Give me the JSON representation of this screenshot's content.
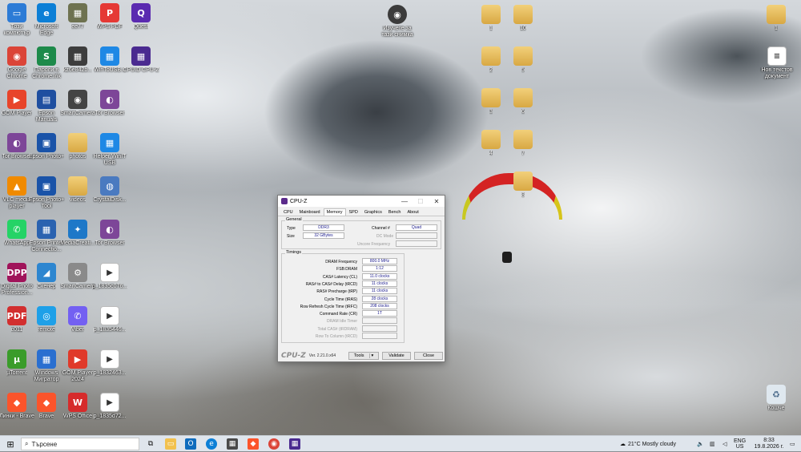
{
  "desktop": {
    "icons": [
      {
        "label": "Този компютър",
        "glyph": "▭",
        "color": "#2c7bd6",
        "col": 0,
        "row": 0
      },
      {
        "label": "Google Chrome",
        "glyph": "◉",
        "color": "#db4437",
        "col": 0,
        "row": 1
      },
      {
        "label": "GOM Player",
        "glyph": "▶",
        "color": "#e8442a",
        "col": 0,
        "row": 2
      },
      {
        "label": "Tor Browser",
        "glyph": "◐",
        "color": "#7d4698",
        "col": 0,
        "row": 3
      },
      {
        "label": "VLC media player",
        "glyph": "▲",
        "color": "#f08a00",
        "col": 0,
        "row": 4
      },
      {
        "label": "WhatsApp",
        "glyph": "✆",
        "color": "#25d366",
        "col": 0,
        "row": 5
      },
      {
        "label": "Digital Photo Profession...",
        "glyph": "DPP",
        "color": "#a0145a",
        "col": 0,
        "row": 6
      },
      {
        "label": "c011",
        "glyph": "PDF",
        "color": "#d22f2f",
        "col": 0,
        "row": 7
      },
      {
        "label": "µTorrent",
        "glyph": "µ",
        "color": "#3a9c2a",
        "col": 0,
        "row": 8
      },
      {
        "label": "Линки - Brave",
        "glyph": "◆",
        "color": "#fb542b",
        "col": 0,
        "row": 9
      },
      {
        "label": "Microsoft Edge",
        "glyph": "e",
        "color": "#0c7fd6",
        "col": 1,
        "row": 0
      },
      {
        "label": "Пароли в Chrome.lnk",
        "glyph": "S",
        "color": "#1d8a4a",
        "col": 1,
        "row": 1
      },
      {
        "label": "Epson Manuals",
        "glyph": "▤",
        "color": "#1f4fa0",
        "col": 1,
        "row": 2
      },
      {
        "label": "Epson Photo+",
        "glyph": "▣",
        "color": "#1a53a8",
        "col": 1,
        "row": 3
      },
      {
        "label": "Epson Photo+ Tool",
        "glyph": "▣",
        "color": "#1a53a8",
        "col": 1,
        "row": 4
      },
      {
        "label": "Epson Printer Connectio...",
        "glyph": "▦",
        "color": "#2a62b0",
        "col": 1,
        "row": 5
      },
      {
        "label": "Скенер",
        "glyph": "◢",
        "color": "#2d86d0",
        "col": 1,
        "row": 6
      },
      {
        "label": "remote",
        "glyph": "◎",
        "color": "#1ea0e8",
        "col": 1,
        "row": 7
      },
      {
        "label": "Windows Мигратор",
        "glyph": "▦",
        "color": "#2a6fd0",
        "col": 1,
        "row": 8
      },
      {
        "label": "Brave",
        "glyph": "◆",
        "color": "#fb542b",
        "col": 1,
        "row": 9
      },
      {
        "label": "ee77",
        "glyph": "▦",
        "color": "#6e7250",
        "col": 2,
        "row": 0
      },
      {
        "label": "kz6e842b...",
        "glyph": "▦",
        "color": "#3d3d3d",
        "col": 2,
        "row": 1
      },
      {
        "label": "SmartCamera",
        "glyph": "◉",
        "color": "#444",
        "col": 2,
        "row": 2
      },
      {
        "label": "photos",
        "glyph": "",
        "color": "folder",
        "col": 2,
        "row": 3
      },
      {
        "label": "videos",
        "glyph": "",
        "color": "folder",
        "col": 2,
        "row": 4
      },
      {
        "label": "MediaCreati...",
        "glyph": "✦",
        "color": "#1e78c8",
        "col": 2,
        "row": 5
      },
      {
        "label": "SmartCamera",
        "glyph": "⚙",
        "color": "#8a8a8a",
        "col": 2,
        "row": 6
      },
      {
        "label": "Viber",
        "glyph": "✆",
        "color": "#7360f2",
        "col": 2,
        "row": 7
      },
      {
        "label": "GOM Player 2024",
        "glyph": "▶",
        "color": "#e03a2a",
        "col": 2,
        "row": 8
      },
      {
        "label": "WPS Office",
        "glyph": "W",
        "color": "#d62b2b",
        "col": 2,
        "row": 9
      },
      {
        "label": "WPS PDF",
        "glyph": "P",
        "color": "#e53935",
        "col": 3,
        "row": 0
      },
      {
        "label": "WinToUSB...",
        "glyph": "▦",
        "color": "#1e88e5",
        "col": 3,
        "row": 1
      },
      {
        "label": "Tor Browser",
        "glyph": "◐",
        "color": "#7d4698",
        "col": 3,
        "row": 2
      },
      {
        "label": "Helper WinIT USB",
        "glyph": "▦",
        "color": "#1e88e5",
        "col": 3,
        "row": 3
      },
      {
        "label": "CrystalDisk...",
        "glyph": "◍",
        "color": "#4a7ac0",
        "col": 3,
        "row": 4
      },
      {
        "label": "Tor Browser",
        "glyph": "◐",
        "color": "#7d4698",
        "col": 3,
        "row": 5
      },
      {
        "label": "p_1835c076...",
        "glyph": "▶",
        "color": "file",
        "col": 3,
        "row": 6
      },
      {
        "label": "p_1835446...",
        "glyph": "▶",
        "color": "file",
        "col": 3,
        "row": 7
      },
      {
        "label": "p_1832463...",
        "glyph": "▶",
        "color": "file",
        "col": 3,
        "row": 8
      },
      {
        "label": "p_1835d72...",
        "glyph": "▶",
        "color": "file",
        "col": 3,
        "row": 9
      },
      {
        "label": "Quest",
        "glyph": "Q",
        "color": "#5a2ab0",
        "col": 4,
        "row": 0
      },
      {
        "label": "CPUID CPU-Z",
        "glyph": "▦",
        "color": "#4a2a90",
        "col": 4,
        "row": 1
      }
    ],
    "mid_icon": {
      "label": "Изучете за тази снимка",
      "glyph": "◉"
    },
    "right_folders": [
      {
        "label": "1"
      },
      {
        "label": "10"
      },
      {
        "label": "2"
      },
      {
        "label": "5"
      },
      {
        "label": "3"
      },
      {
        "label": "6"
      },
      {
        "label": "4"
      },
      {
        "label": "7"
      },
      {
        "label": "8"
      }
    ],
    "far_right": [
      {
        "label": "1",
        "type": "folder"
      },
      {
        "label": "Нов текстов документ",
        "type": "file"
      },
      {
        "label": "Кошче",
        "type": "bin"
      }
    ]
  },
  "cpuz": {
    "title": "CPU-Z",
    "tabs": [
      "CPU",
      "Mainboard",
      "Memory",
      "SPD",
      "Graphics",
      "Bench",
      "About"
    ],
    "active_tab": "Memory",
    "general": {
      "heading": "General",
      "type_label": "Type",
      "type_value": "DDR3",
      "size_label": "Size",
      "size_value": "32 GBytes",
      "channel_label": "Channel #",
      "channel_value": "Quad",
      "dc_label": "DC Mode",
      "uncore_label": "Uncore Frequency"
    },
    "timings": {
      "heading": "Timings",
      "rows": [
        {
          "label": "DRAM Frequency",
          "value": "800.0 MHz",
          "dim": false
        },
        {
          "label": "FSB:DRAM",
          "value": "1:12",
          "dim": false
        },
        {
          "label": "CAS# Latency (CL)",
          "value": "11.0 clocks",
          "dim": false
        },
        {
          "label": "RAS# to CAS# Delay (tRCD)",
          "value": "11 clocks",
          "dim": false
        },
        {
          "label": "RAS# Precharge (tRP)",
          "value": "11 clocks",
          "dim": false
        },
        {
          "label": "Cycle Time (tRAS)",
          "value": "28 clocks",
          "dim": false
        },
        {
          "label": "Row Refresh Cycle Time (tRFC)",
          "value": "208 clocks",
          "dim": false
        },
        {
          "label": "Command Rate (CR)",
          "value": "1T",
          "dim": false
        },
        {
          "label": "DRAM Idle Timer",
          "value": "",
          "dim": true
        },
        {
          "label": "Total CAS# (tRDRAM)",
          "value": "",
          "dim": true
        },
        {
          "label": "Row To Column (tRCD)",
          "value": "",
          "dim": true
        }
      ]
    },
    "logo": "CPU-Z",
    "version": "Ver. 2.21.0.x64",
    "tools_label": "Tools",
    "validate_label": "Validate",
    "close_label": "Close"
  },
  "taskbar": {
    "search_placeholder": "Търсене",
    "weather": "21°C  Mostly cloudy",
    "lang_top": "ENG",
    "lang_bottom": "US",
    "time": "8:33",
    "date": "19.8.2026 г."
  }
}
